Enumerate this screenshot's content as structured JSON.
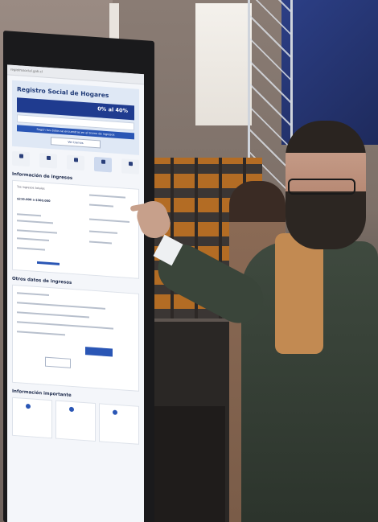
{
  "screen": {
    "browser_url": "registrosocial.gob.cl",
    "page_title": "Registro Social de Hogares",
    "tramo_label": "0% al 40%",
    "hero_band_text": "Según tus datos se encuentras en el tramo de ingresos",
    "hero_button_label": "Ver tramos",
    "tabs": [
      {
        "label": "Inicio"
      },
      {
        "label": "Integrantes"
      },
      {
        "label": "Vivienda"
      },
      {
        "label": "Ingresos"
      },
      {
        "label": "Otros"
      }
    ],
    "section_ingresos": "Información de ingresos",
    "card_title": "Tus ingresos totales",
    "card_value": "$210.000 a $300.000",
    "section_otros": "Otros datos de ingresos",
    "section_importante": "Información importante"
  }
}
